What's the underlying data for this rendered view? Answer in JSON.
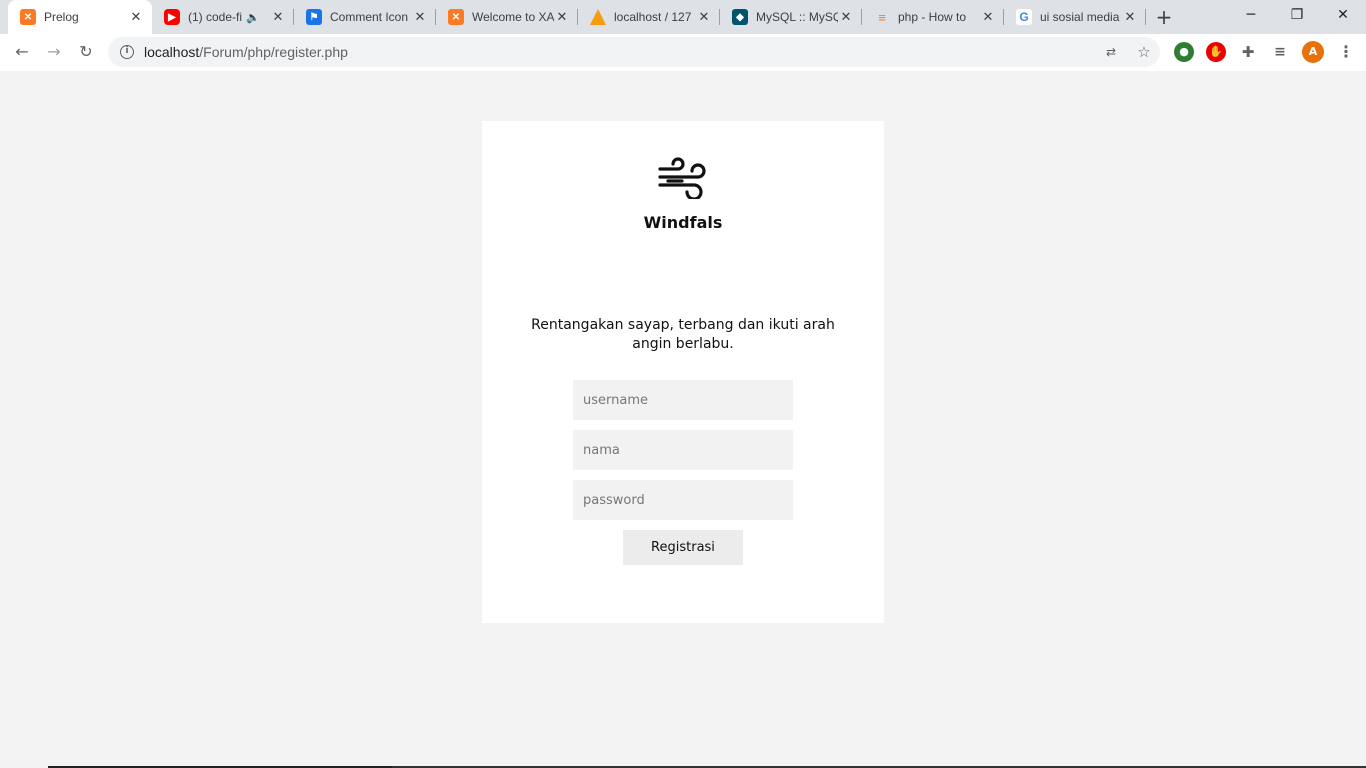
{
  "browser": {
    "tabs": [
      {
        "title": "Prelog",
        "icon": "xampp-icon",
        "active": true
      },
      {
        "title": "(1) code-fi",
        "icon": "youtube-icon",
        "audio": true
      },
      {
        "title": "Comment Icon",
        "icon": "flag-icon"
      },
      {
        "title": "Welcome to XA",
        "icon": "xampp-icon"
      },
      {
        "title": "localhost / 127",
        "icon": "phpmyadmin-icon"
      },
      {
        "title": "MySQL :: MySQ",
        "icon": "mysql-icon"
      },
      {
        "title": "php - How to",
        "icon": "stackoverflow-icon"
      },
      {
        "title": "ui sosial media",
        "icon": "google-icon"
      }
    ],
    "url_host": "localhost",
    "url_path": "/Forum/php/register.php",
    "profile_initial": "A"
  },
  "page": {
    "brand": "Windfals",
    "tagline": "Rentangakan sayap, terbang dan ikuti arah angin berlabu.",
    "form": {
      "username_placeholder": "username",
      "nama_placeholder": "nama",
      "password_placeholder": "password",
      "submit_label": "Registrasi"
    }
  }
}
